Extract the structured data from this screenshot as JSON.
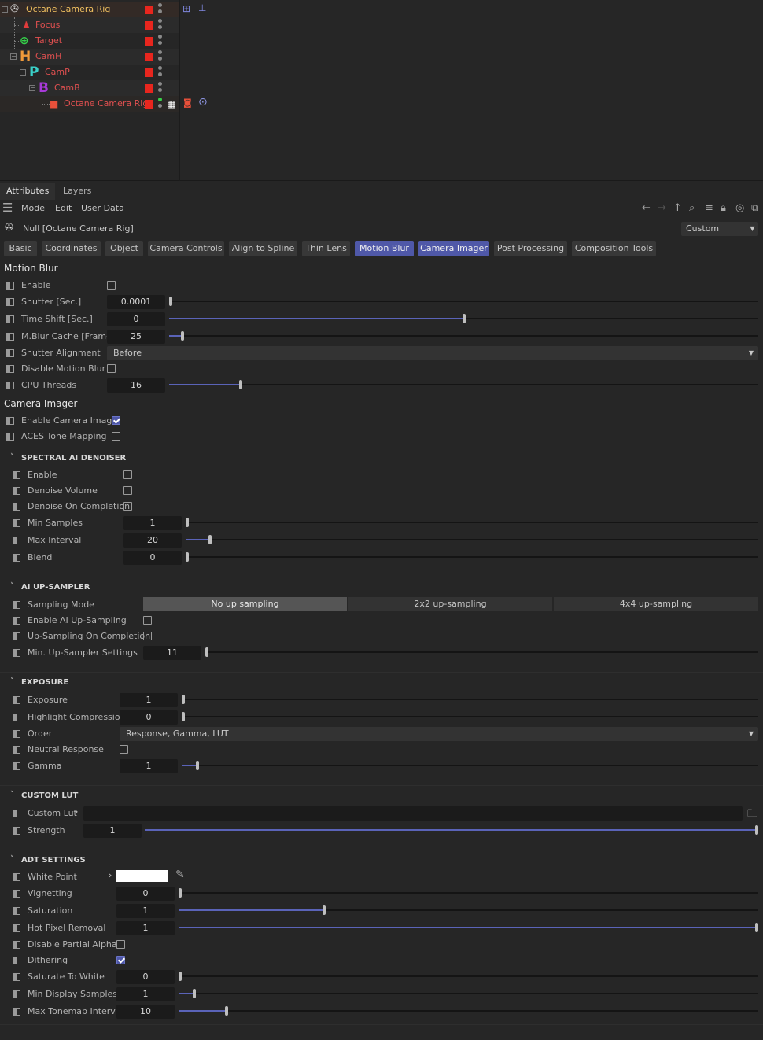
{
  "object_manager": {
    "rows": [
      {
        "name": "Octane Camera Rig",
        "icon": "rig-icon",
        "color": "#f0c060"
      },
      {
        "name": "Focus",
        "icon": "focus-icon",
        "color": "#e03c3c"
      },
      {
        "name": "Target",
        "icon": "target-icon",
        "color": "#35d24a"
      },
      {
        "name": "CamH",
        "icon": "H",
        "color": "#ef9a3a"
      },
      {
        "name": "CamP",
        "icon": "P",
        "color": "#3ad0c8"
      },
      {
        "name": "CamB",
        "icon": "B",
        "color": "#a83ad8"
      },
      {
        "name": "Octane Camera Rig",
        "icon": "camera-icon",
        "color": "#e8503a"
      }
    ]
  },
  "panel_tabs": [
    "Attributes",
    "Layers"
  ],
  "menu": [
    "Mode",
    "Edit",
    "User Data"
  ],
  "object_title": "Null [Octane Camera Rig]",
  "preset": "Custom",
  "tabs": [
    "Basic",
    "Coordinates",
    "Object",
    "Camera Controls",
    "Align to Spline",
    "Thin Lens",
    "Motion Blur",
    "Camera Imager",
    "Post Processing",
    "Composition Tools"
  ],
  "motion_blur": {
    "title": "Motion Blur",
    "enable": "Enable",
    "shutter": {
      "label": "Shutter [Sec.]",
      "value": "0.0001",
      "level": 0
    },
    "time_shift": {
      "label": "Time Shift [Sec.]",
      "value": "0",
      "level": 0.5
    },
    "mblur_cache": {
      "label": "M.Blur Cache [Frame]",
      "value": "25",
      "level": 0.02
    },
    "shutter_alignment": {
      "label": "Shutter Alignment",
      "value": "Before"
    },
    "disable_motion_blur": "Disable Motion Blur",
    "cpu_threads": {
      "label": "CPU Threads",
      "value": "16",
      "level": 0.12
    }
  },
  "camera_imager": {
    "title": "Camera Imager",
    "enable_camera_imager": "Enable Camera Imager",
    "aces_tone_mapping": "ACES Tone Mapping"
  },
  "denoiser": {
    "title": "SPECTRAL AI DENOISER",
    "enable": "Enable",
    "denoise_volume": "Denoise Volume",
    "denoise_on_completion": "Denoise On Completion",
    "min_samples": {
      "label": "Min Samples",
      "value": "1",
      "level": 0
    },
    "max_interval": {
      "label": "Max Interval",
      "value": "20",
      "level": 0.04
    },
    "blend": {
      "label": "Blend",
      "value": "0",
      "level": 0
    }
  },
  "upsampler": {
    "title": "AI UP-SAMPLER",
    "sampling_mode": "Sampling Mode",
    "modes": [
      "No up sampling",
      "2x2 up-sampling",
      "4x4 up-sampling"
    ],
    "enable": "Enable AI Up-Sampling",
    "on_completion": "Up-Sampling On Completion",
    "min_settings": {
      "label": "Min. Up-Sampler Settings",
      "value": "11",
      "level": 0
    }
  },
  "exposure": {
    "title": "EXPOSURE",
    "exposure": {
      "label": "Exposure",
      "value": "1",
      "level": 0
    },
    "highlight": {
      "label": "Highlight Compression",
      "value": "0",
      "level": 0
    },
    "order": {
      "label": "Order",
      "value": "Response, Gamma, LUT"
    },
    "neutral": "Neutral Response",
    "gamma": {
      "label": "Gamma",
      "value": "1",
      "level": 0.025
    }
  },
  "lut": {
    "title": "CUSTOM LUT",
    "custom_lut": "Custom Lut",
    "strength": {
      "label": "Strength",
      "value": "1",
      "level": 1
    }
  },
  "adt": {
    "title": "ADT SETTINGS",
    "white_point": "White Point",
    "white_color": "#ffffff",
    "vignetting": {
      "label": "Vignetting",
      "value": "0",
      "level": 0
    },
    "saturation": {
      "label": "Saturation",
      "value": "1",
      "level": 0.25
    },
    "hot_pixel": {
      "label": "Hot Pixel Removal",
      "value": "1",
      "level": 1
    },
    "partial_alpha": "Disable Partial Alpha",
    "dithering": "Dithering",
    "saturate_white": {
      "label": "Saturate To White",
      "value": "0",
      "level": 0
    },
    "min_display": {
      "label": "Min Display Samples",
      "value": "1",
      "level": 0.025
    },
    "max_tonemap": {
      "label": "Max Tonemap Interval",
      "value": "10",
      "level": 0.08
    }
  },
  "accent": "#4f58a8"
}
